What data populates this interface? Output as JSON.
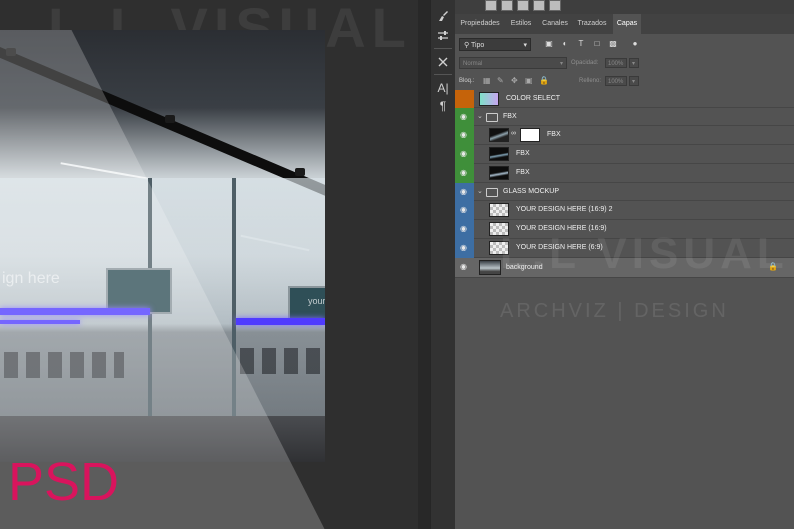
{
  "watermark": {
    "title": "L.L VISUAL",
    "subtitle": "ARCHVIZ | DESIGN"
  },
  "canvas": {
    "format_label": "PSD",
    "glass_text": "ign here",
    "glass_text_2": "your",
    "colors": {
      "format_label": "#d9145d",
      "neon": "#4f3bff"
    }
  },
  "tools": [
    "brush-tool-icon",
    "adjust-sliders-icon",
    "tools-icon",
    "character-icon",
    "paragraph-icon"
  ],
  "tools_glyphs": {
    "character": "A|",
    "paragraph": "¶"
  },
  "panel": {
    "tabs": [
      {
        "label": "Propiedades",
        "active": false
      },
      {
        "label": "Estilos",
        "active": false
      },
      {
        "label": "Canales",
        "active": false
      },
      {
        "label": "Trazados",
        "active": false
      },
      {
        "label": "Capas",
        "active": true
      }
    ],
    "filter": {
      "label": "Tipo"
    },
    "blend": {
      "mode": "Normal",
      "opacity_label": "Opacidad:",
      "opacity_value": "100%"
    },
    "lock": {
      "label": "Bloq.:",
      "fill_label": "Relleno:",
      "fill_value": "100%"
    },
    "layers": [
      {
        "name": "COLOR SELECT",
        "visible": false,
        "label_color": "#c5630a",
        "type": "adjustment"
      },
      {
        "name": "FBX",
        "visible": true,
        "label_color": "#3f8f3a",
        "type": "group"
      },
      {
        "name": "FBX",
        "visible": true,
        "label_color": "#3f8f3a",
        "type": "masked"
      },
      {
        "name": "FBX",
        "visible": true,
        "label_color": "#3f8f3a",
        "type": "image"
      },
      {
        "name": "FBX",
        "visible": true,
        "label_color": "#3f8f3a",
        "type": "image"
      },
      {
        "name": "GLASS MOCKUP",
        "visible": true,
        "label_color": "#3d6ea3",
        "type": "group"
      },
      {
        "name": "YOUR DESIGN HERE (16:9) 2",
        "visible": true,
        "label_color": "#3d6ea3",
        "type": "smart"
      },
      {
        "name": "YOUR DESIGN HERE (16:9)",
        "visible": true,
        "label_color": "#3d6ea3",
        "type": "smart"
      },
      {
        "name": "YOUR DESIGN HERE (6:9)",
        "visible": true,
        "label_color": "#3d6ea3",
        "type": "smart"
      },
      {
        "name": "background",
        "visible": true,
        "label_color": "",
        "type": "background",
        "locked": true
      }
    ]
  }
}
